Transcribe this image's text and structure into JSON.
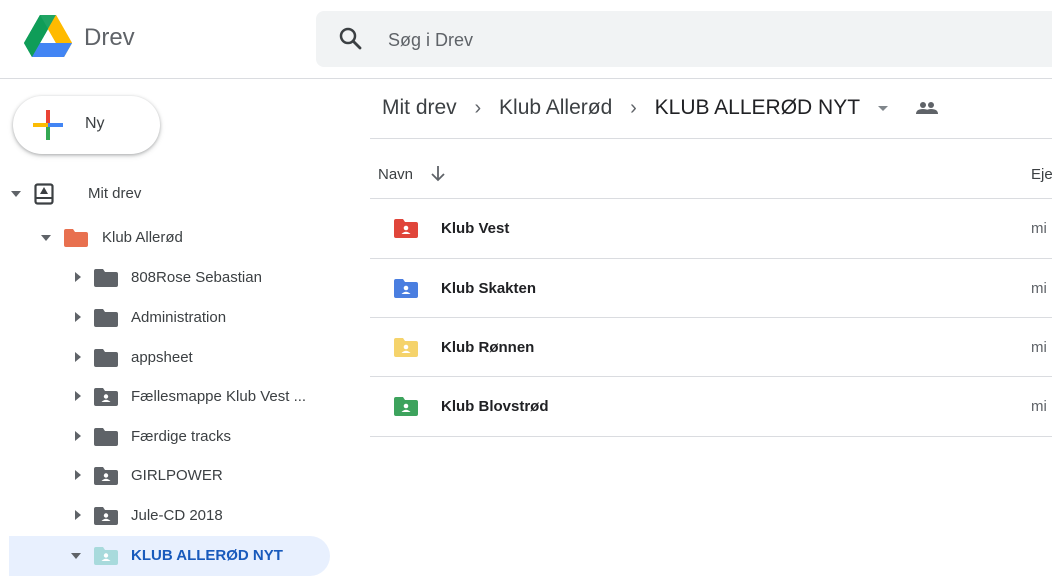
{
  "header": {
    "app_name": "Drev",
    "search_placeholder": "Søg i Drev"
  },
  "sidebar": {
    "new_label": "Ny",
    "tree": [
      {
        "label": "Mit drev",
        "expanded": true,
        "icon": "my-drive-icon"
      },
      {
        "label": "Klub Allerød",
        "expanded": true,
        "icon": "folder-icon",
        "color": "#e8704f"
      },
      {
        "label": "808Rose Sebastian",
        "icon": "folder-icon"
      },
      {
        "label": "Administration",
        "icon": "folder-icon"
      },
      {
        "label": "appsheet",
        "icon": "folder-icon"
      },
      {
        "label": "Fællesmappe Klub Vest ...",
        "icon": "shared-folder-icon"
      },
      {
        "label": "Færdige tracks",
        "icon": "folder-icon"
      },
      {
        "label": "GIRLPOWER",
        "icon": "shared-folder-icon"
      },
      {
        "label": "Jule-CD 2018",
        "icon": "shared-folder-icon"
      },
      {
        "label": "KLUB ALLERØD NYT",
        "expanded": true,
        "selected": true,
        "icon": "shared-folder-icon",
        "color": "#a8dadc"
      }
    ]
  },
  "breadcrumb": {
    "items": [
      "Mit drev",
      "Klub Allerød"
    ],
    "current": "KLUB ALLERØD NYT"
  },
  "table": {
    "headers": {
      "name": "Navn",
      "owner": "Eje"
    },
    "rows": [
      {
        "name": "Klub Vest",
        "owner": "mi",
        "color": "#e0453a"
      },
      {
        "name": "Klub Skakten",
        "owner": "mi",
        "color": "#4a7ee0"
      },
      {
        "name": "Klub Rønnen",
        "owner": "mi",
        "color": "#f5d36b"
      },
      {
        "name": "Klub Blovstrød",
        "owner": "mi",
        "color": "#3da35d"
      }
    ]
  },
  "colors": {
    "selected_bg": "#e8f0fe",
    "selected_text": "#185abc",
    "folder_grey": "#5f6368",
    "divider": "#dadce0"
  }
}
